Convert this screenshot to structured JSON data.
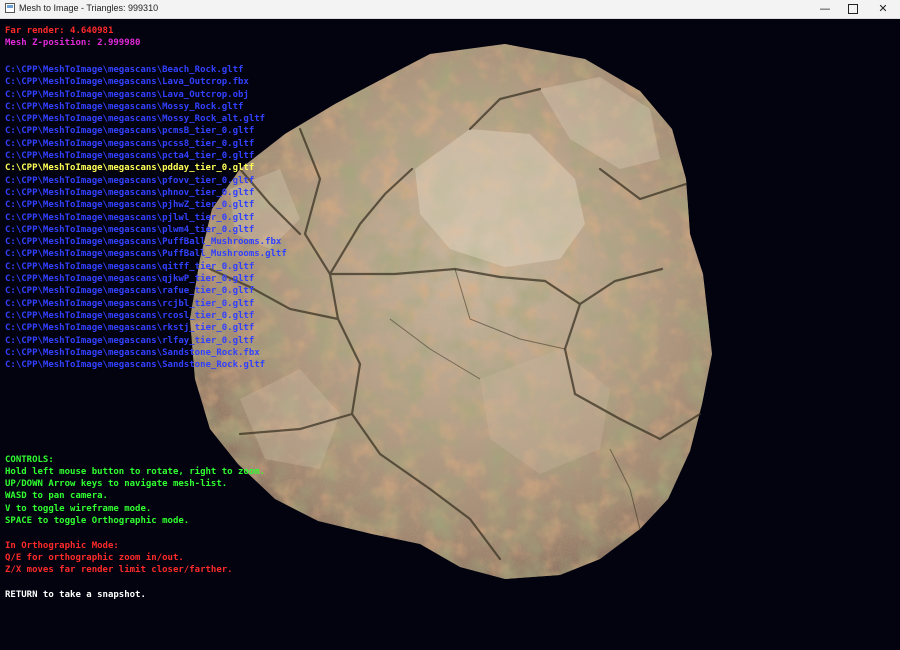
{
  "window": {
    "title": "Mesh to Image  -  Triangles: 999310",
    "minimize_glyph": "—",
    "close_glyph": "✕"
  },
  "hud": {
    "far_render": "Far render: 4.640981",
    "mesh_z": "Mesh Z-position: 2.999980"
  },
  "file_list": {
    "selected_index": 8,
    "items": [
      "C:\\CPP\\MeshToImage\\megascans\\Beach_Rock.gltf",
      "C:\\CPP\\MeshToImage\\megascans\\Lava_Outcrop.fbx",
      "C:\\CPP\\MeshToImage\\megascans\\Lava_Outcrop.obj",
      "C:\\CPP\\MeshToImage\\megascans\\Mossy_Rock.gltf",
      "C:\\CPP\\MeshToImage\\megascans\\Mossy_Rock_alt.gltf",
      "C:\\CPP\\MeshToImage\\megascans\\pcmsB_tier_0.gltf",
      "C:\\CPP\\MeshToImage\\megascans\\pcss8_tier_0.gltf",
      "C:\\CPP\\MeshToImage\\megascans\\pcta4_tier_0.gltf",
      "C:\\CPP\\MeshToImage\\megascans\\pdday_tier_0.gltf",
      "C:\\CPP\\MeshToImage\\megascans\\pfovv_tier_0.gltf",
      "C:\\CPP\\MeshToImage\\megascans\\phnov_tier_0.gltf",
      "C:\\CPP\\MeshToImage\\megascans\\pjhwZ_tier_0.gltf",
      "C:\\CPP\\MeshToImage\\megascans\\pjlwl_tier_0.gltf",
      "C:\\CPP\\MeshToImage\\megascans\\plwm4_tier_0.gltf",
      "C:\\CPP\\MeshToImage\\megascans\\PuffBall_Mushrooms.fbx",
      "C:\\CPP\\MeshToImage\\megascans\\PuffBall_Mushrooms.gltf",
      "C:\\CPP\\MeshToImage\\megascans\\qitff_tier_0.gltf",
      "C:\\CPP\\MeshToImage\\megascans\\qjkwP_tier_0.gltf",
      "C:\\CPP\\MeshToImage\\megascans\\rafue_tier_0.gltf",
      "C:\\CPP\\MeshToImage\\megascans\\rcjbl_tier_0.gltf",
      "C:\\CPP\\MeshToImage\\megascans\\rcosl_tier_0.gltf",
      "C:\\CPP\\MeshToImage\\megascans\\rkstj_tier_0.gltf",
      "C:\\CPP\\MeshToImage\\megascans\\rlfay_tier_0.gltf",
      "C:\\CPP\\MeshToImage\\megascans\\Sandstone_Rock.fbx",
      "C:\\CPP\\MeshToImage\\megascans\\Sandstone_Rock.gltf"
    ]
  },
  "controls": {
    "header": "CONTROLS:",
    "lines": [
      "Hold left mouse button to rotate, right to zoom.",
      "UP/DOWN Arrow keys to navigate mesh-list.",
      "WASD to pan camera.",
      "V to toggle wireframe mode.",
      "SPACE to toggle Orthographic mode."
    ]
  },
  "ortho": {
    "header": "In Orthographic Mode:",
    "lines": [
      "Q/E for orthographic zoom in/out.",
      "Z/X moves far render limit closer/farther."
    ]
  },
  "snapshot": "RETURN to take a snapshot.",
  "colors": {
    "background": "#02030f",
    "list_text": "#3240ff",
    "selected_text": "#ffff55",
    "controls_text": "#30ff30",
    "ortho_text": "#ff2a2a"
  }
}
